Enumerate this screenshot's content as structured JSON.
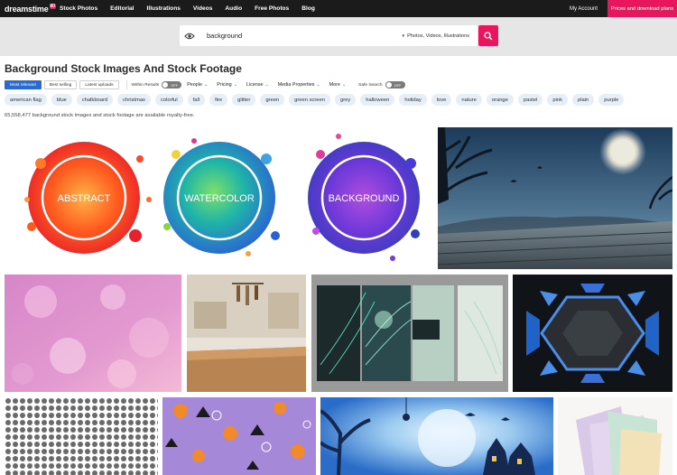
{
  "nav": {
    "logo": "dreamstime",
    "logo_badge": "60",
    "links": [
      "Stock Photos",
      "Editorial",
      "Illustrations",
      "Videos",
      "Audio",
      "Free Photos",
      "Blog"
    ],
    "account": "My Account",
    "pricing": "Prices and download plans"
  },
  "search": {
    "query": "background",
    "scope": "Photos, Videos, Illustrations"
  },
  "page": {
    "title": "Background Stock Images And Stock Footage",
    "count_text": "65,558,477 background stock images and stock footage are available royalty-free."
  },
  "filters": {
    "sort_tabs": [
      "Most relevant",
      "Best selling",
      "Latest uploads"
    ],
    "within_label": "Within Results",
    "toggle_off": "OFF",
    "dropdowns": [
      "People",
      "Pricing",
      "License",
      "Media Properties",
      "More"
    ],
    "safe_label": "Safe Search",
    "safe_toggle": "OFF"
  },
  "tags": [
    "american flag",
    "blue",
    "chalkboard",
    "christmas",
    "colorful",
    "fall",
    "fire",
    "glitter",
    "green",
    "green screen",
    "grey",
    "halloween",
    "holiday",
    "love",
    "nature",
    "orange",
    "pastel",
    "pink",
    "plain",
    "purple"
  ],
  "images": {
    "watercolor_words": [
      "ABSTRACT",
      "WATERCOLOR",
      "BACKGROUND"
    ]
  },
  "colors": {
    "accent": "#e8175d",
    "active_tab": "#2a6bd3",
    "nav_bg": "#1b1b1b",
    "tag_bg": "#e6eef8"
  }
}
